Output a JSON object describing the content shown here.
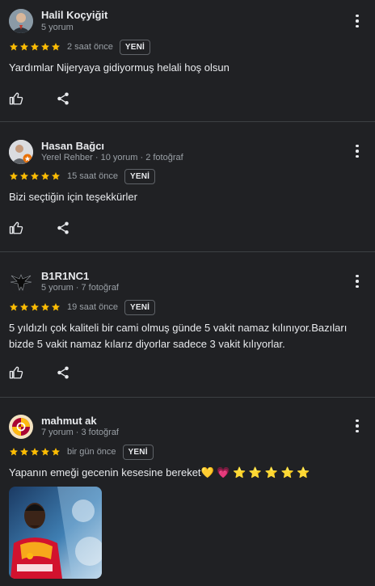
{
  "colors": {
    "background": "#202124",
    "star": "#fbbc04",
    "divider": "#3c4043"
  },
  "reviews": [
    {
      "name": "Halil Koçyiğit",
      "meta": "5 yorum",
      "rating": 5,
      "time": "2 saat önce",
      "badge": "YENİ",
      "text": "Yardımlar Nijeryaya gidiyormuş helali hoş olsun",
      "avatar_icon": "person-photo-avatar"
    },
    {
      "name": "Hasan Bağcı",
      "meta": "Yerel Rehber · 10 yorum · 2 fotoğraf",
      "rating": 5,
      "time": "15 saat önce",
      "badge": "YENİ",
      "text": "Bizi seçtiğin için teşekkürler",
      "avatar_icon": "local-guide-avatar"
    },
    {
      "name": "B1R1NC1",
      "meta": "5 yorum · 7 fotoğraf",
      "rating": 5,
      "time": "19 saat önce",
      "badge": "YENİ",
      "text": "5 yıldızlı çok kaliteli bir cami olmuş günde 5 vakit namaz kılınıyor.Bazıları bizde 5 vakit namaz kılarız diyorlar sadece 3 vakit kılıyorlar.",
      "avatar_icon": "eagle-avatar"
    },
    {
      "name": "mahmut ak",
      "meta": "7 yorum · 3 fotoğraf",
      "rating": 5,
      "time": "bir gün önce",
      "badge": "YENİ",
      "text": "Yapanın emeği gecenin kesesine bereket💛 💗 ⭐ ⭐ ⭐ ⭐ ⭐",
      "avatar_icon": "galatasaray-logo-avatar",
      "photo": "football-player-photo"
    }
  ]
}
